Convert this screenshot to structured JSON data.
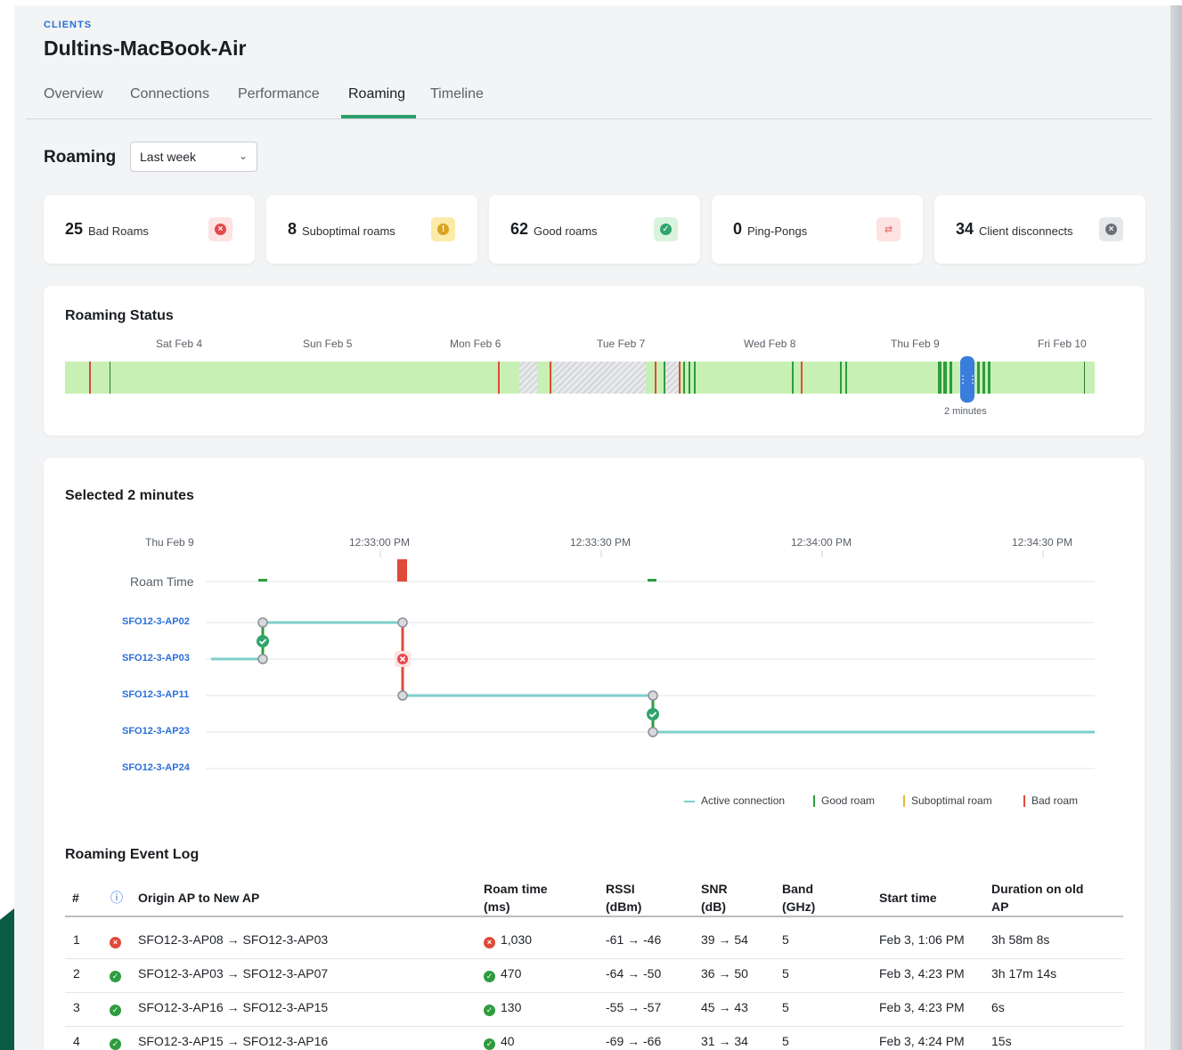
{
  "header": {
    "eyebrow": "CLIENTS",
    "title": "Dultins-MacBook-Air"
  },
  "tabs": [
    {
      "label": "Overview"
    },
    {
      "label": "Connections"
    },
    {
      "label": "Performance"
    },
    {
      "label": "Roaming",
      "active": true
    },
    {
      "label": "Timeline"
    }
  ],
  "section": {
    "title": "Roaming",
    "range_select": "Last week"
  },
  "kpis": [
    {
      "value": "25",
      "label": "Bad Roams",
      "icon": "x-circle-icon",
      "color": "#e5484d"
    },
    {
      "value": "8",
      "label": "Suboptimal roams",
      "icon": "warning-icon",
      "color": "#e8b53c"
    },
    {
      "value": "62",
      "label": "Good roams",
      "icon": "check-circle-icon",
      "color": "#30a46c"
    },
    {
      "value": "0",
      "label": "Ping-Pongs",
      "icon": "ping-pong-icon",
      "color": "#ec8a8a"
    },
    {
      "value": "34",
      "label": "Client disconnects",
      "icon": "disconnect-icon",
      "color": "#6b7078"
    }
  ],
  "roaming_status": {
    "title": "Roaming Status",
    "days": [
      "Sat Feb 4",
      "Sun Feb 5",
      "Mon Feb 6",
      "Tue Feb 7",
      "Wed Feb 8",
      "Thu Feb 9",
      "Fri Feb 10"
    ],
    "selection_label": "2 minutes"
  },
  "selected": {
    "title": "Selected 2 minutes",
    "date_label": "Thu Feb 9",
    "times": [
      "12:33:00 PM",
      "12:33:30 PM",
      "12:34:00 PM",
      "12:34:30 PM"
    ],
    "roam_time_label": "Roam Time",
    "aps": [
      "SFO12-3-AP02",
      "SFO12-3-AP03",
      "SFO12-3-AP11",
      "SFO12-3-AP23",
      "SFO12-3-AP24"
    ],
    "legend": [
      "Active connection",
      "Good roam",
      "Suboptimal roam",
      "Bad roam"
    ]
  },
  "colors": {
    "active": "#7ecfcb",
    "good": "#2e9c3f",
    "suboptimal": "#e8b53c",
    "bad": "#e04a3a"
  },
  "log": {
    "title": "Roaming Event Log",
    "headers": {
      "num": "#",
      "origin": "Origin AP to New AP",
      "roam_time_1": "Roam time",
      "roam_time_2": "(ms)",
      "rssi_1": "RSSI",
      "rssi_2": "(dBm)",
      "snr_1": "SNR",
      "snr_2": "(dB)",
      "band_1": "Band",
      "band_2": "(GHz)",
      "start": "Start time",
      "duration_1": "Duration on old",
      "duration_2": "AP"
    },
    "rows": [
      {
        "num": "1",
        "status": "bad",
        "origin": "SFO12-3-AP08 → SFO12-3-AP03",
        "roam_time": "1,030",
        "rssi": "-61 → -46",
        "snr": "39 → 54",
        "band": "5",
        "start": "Feb 3, 1:06 PM",
        "duration": "3h 58m 8s"
      },
      {
        "num": "2",
        "status": "good",
        "origin": "SFO12-3-AP03 → SFO12-3-AP07",
        "roam_time": "470",
        "rssi": "-64 → -50",
        "snr": "36 → 50",
        "band": "5",
        "start": "Feb 3, 4:23 PM",
        "duration": "3h 17m 14s"
      },
      {
        "num": "3",
        "status": "good",
        "origin": "SFO12-3-AP16 → SFO12-3-AP15",
        "roam_time": "130",
        "rssi": "-55 → -57",
        "snr": "45 → 43",
        "band": "5",
        "start": "Feb 3, 4:23 PM",
        "duration": "6s"
      },
      {
        "num": "4",
        "status": "good",
        "origin": "SFO12-3-AP15 → SFO12-3-AP16",
        "roam_time": "40",
        "rssi": "-69 → -66",
        "snr": "31 → 34",
        "band": "5",
        "start": "Feb 3, 4:24 PM",
        "duration": "15s"
      }
    ]
  }
}
